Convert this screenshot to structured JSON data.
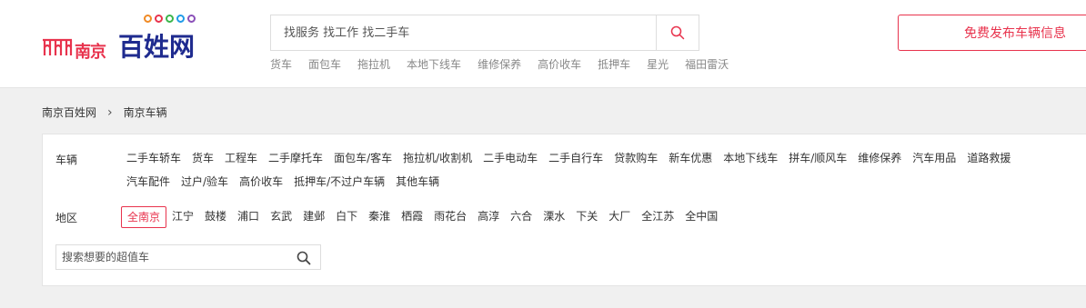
{
  "logo": {
    "city": "南京",
    "brand": "百姓网",
    "dot_colors": [
      "#f08a24",
      "#e8334d",
      "#3ab54a",
      "#1f9be8",
      "#8a4fb8"
    ],
    "accent": "#e8334d",
    "brand_color": "#1f2b8f"
  },
  "search": {
    "placeholder": "找服务 找工作 找二手车",
    "button_icon": "search-icon"
  },
  "hotwords": [
    "货车",
    "面包车",
    "拖拉机",
    "本地下线车",
    "维修保养",
    "高价收车",
    "抵押车",
    "星光",
    "福田雷沃"
  ],
  "publish_label": "免费发布车辆信息",
  "breadcrumb": {
    "home": "南京百姓网",
    "separator": "›",
    "current": "南京车辆"
  },
  "filters": {
    "category_label": "车辆",
    "categories": [
      "二手车轿车",
      "货车",
      "工程车",
      "二手摩托车",
      "面包车/客车",
      "拖拉机/收割机",
      "二手电动车",
      "二手自行车",
      "贷款购车",
      "新车优惠",
      "本地下线车",
      "拼车/顺风车",
      "维修保养",
      "汽车用品",
      "道路救援",
      "汽车配件",
      "过户/验车",
      "高价收车",
      "抵押车/不过户车辆",
      "其他车辆"
    ],
    "region_label": "地区",
    "regions": [
      "全南京",
      "江宁",
      "鼓楼",
      "浦口",
      "玄武",
      "建邺",
      "白下",
      "秦淮",
      "栖霞",
      "雨花台",
      "高淳",
      "六合",
      "溧水",
      "下关",
      "大厂",
      "全江苏",
      "全中国"
    ],
    "active_region": "全南京",
    "search_placeholder": "搜索想要的超值车"
  }
}
